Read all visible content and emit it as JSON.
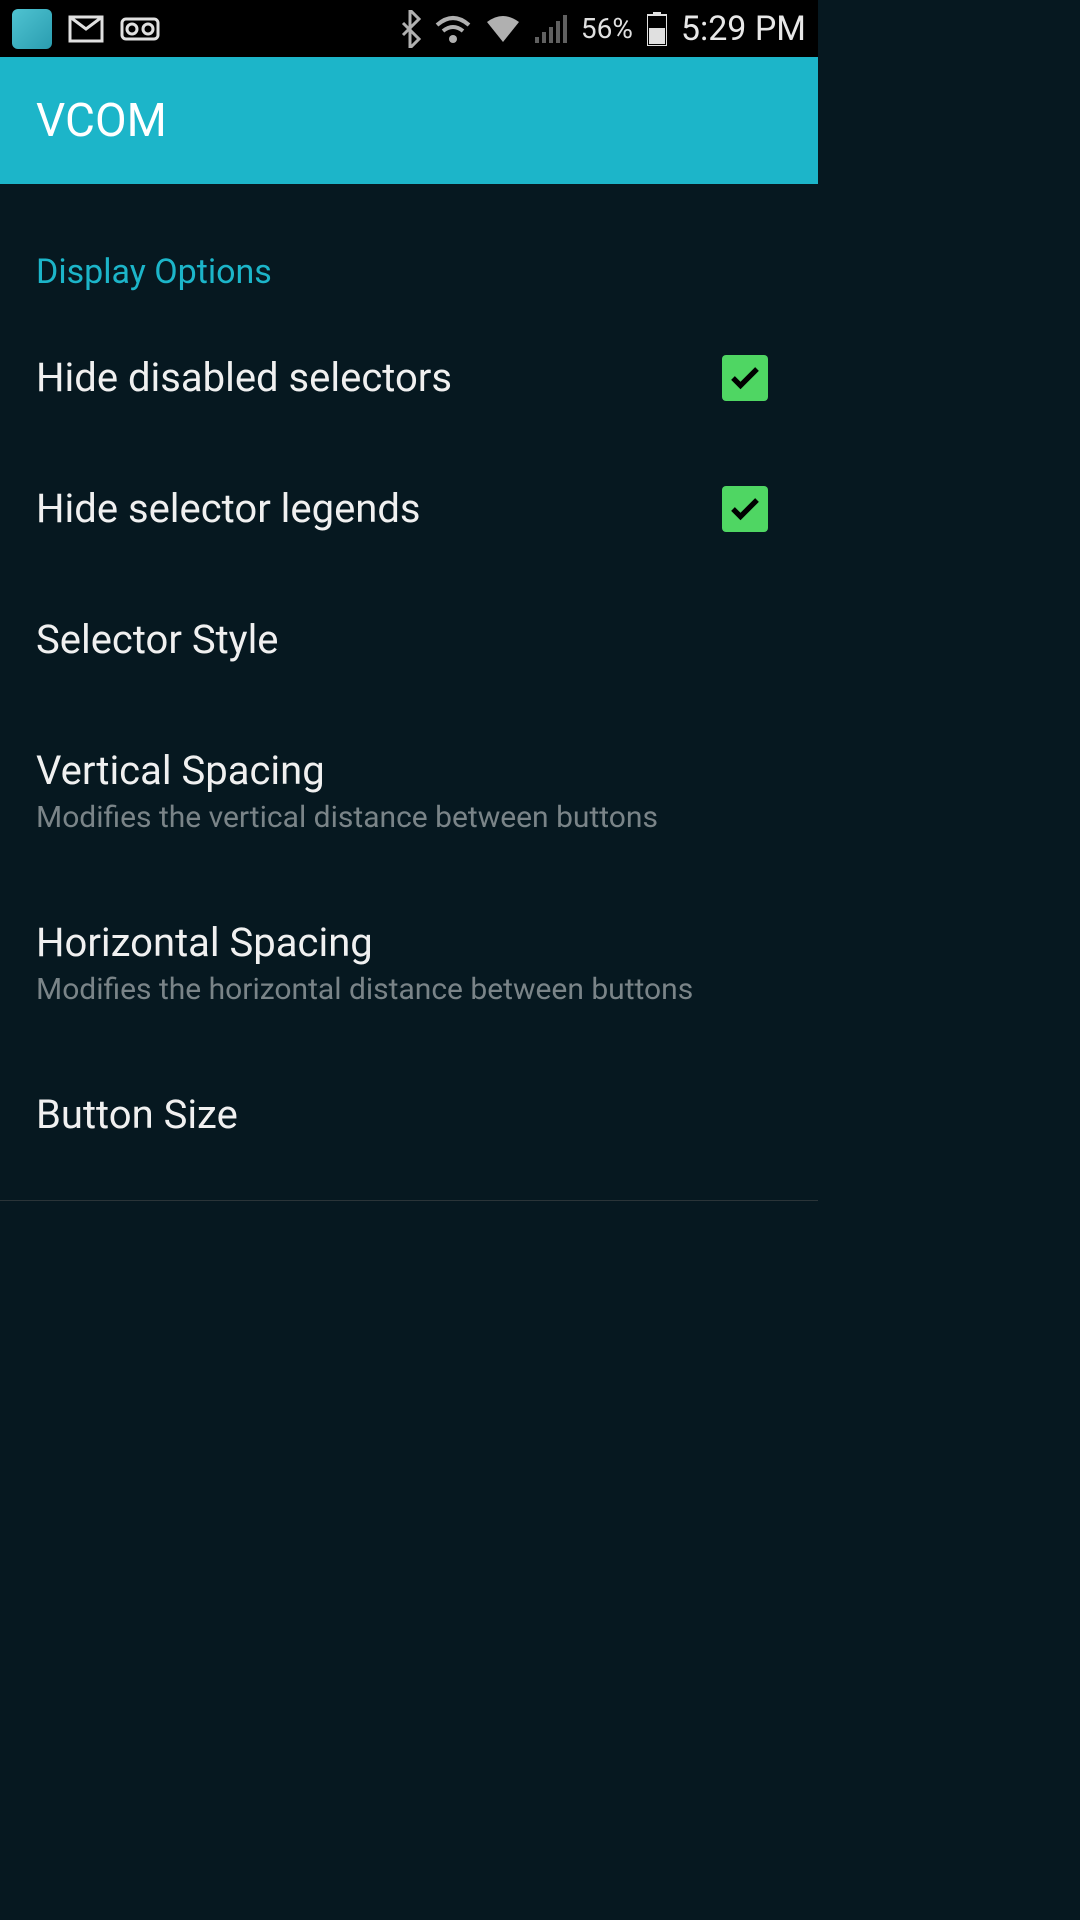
{
  "statusBar": {
    "battery": "56%",
    "time": "5:29 PM"
  },
  "appBar": {
    "title": "VCOM"
  },
  "section": {
    "header": "Display Options"
  },
  "items": [
    {
      "title": "Hide disabled selectors",
      "hasCheckbox": true,
      "checked": true
    },
    {
      "title": "Hide selector legends",
      "hasCheckbox": true,
      "checked": true
    },
    {
      "title": "Selector Style"
    },
    {
      "title": "Vertical Spacing",
      "subtitle": "Modifies the vertical distance between buttons"
    },
    {
      "title": "Horizontal Spacing",
      "subtitle": "Modifies the horizontal distance between buttons"
    },
    {
      "title": "Button Size"
    }
  ]
}
